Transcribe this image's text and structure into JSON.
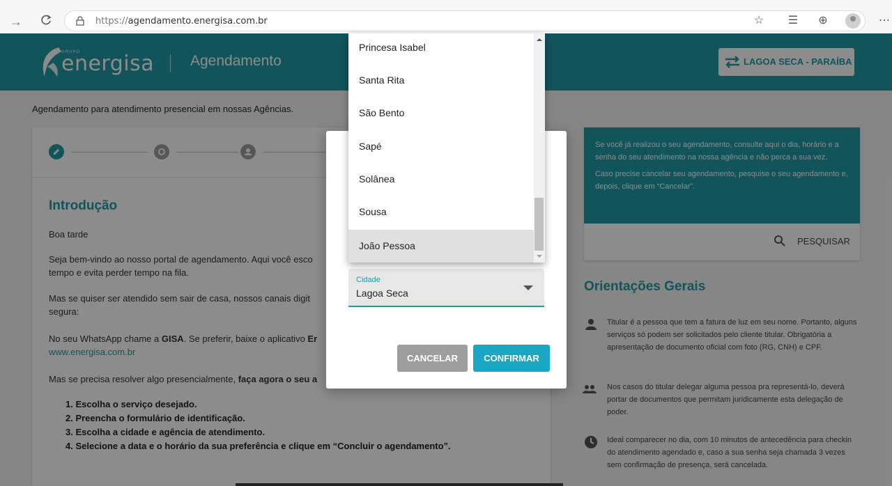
{
  "browser": {
    "url_scheme": "https://",
    "url_host": "agendamento.energisa.com.br"
  },
  "header": {
    "logo_group": "GRUPO",
    "logo_name": "energisa",
    "title": "Agendamento",
    "location_button": "LAGOA SECA - PARAÍBA"
  },
  "intro_line": "Agendamento para atendimento presencial em nossas Agências.",
  "main": {
    "section_title": "Introdução",
    "greeting": "Boa tarde",
    "p1_line1": "Seja bem-vindo ao nosso portal de agendamento. Aqui você esco",
    "p1_line2": "tempo e evita perder tempo na fila.",
    "p2_line1": "Mas se quiser ser atendido sem sair de casa, nossos canais digit",
    "p2_line2": "segura:",
    "p3_prefix": "No seu WhatsApp chame a ",
    "p3_gisa": "GISA",
    "p3_mid": ". Se preferir, baixe o aplicativo ",
    "p3_bold": "Er",
    "p3_link": "www.energisa.com.br",
    "p4_prefix": "Mas se precisa resolver algo presencialmente, ",
    "p4_bold": "faça agora o seu a",
    "steps": [
      "1. Escolha o serviço desejado.",
      "2. Preencha o formulário de identificação.",
      "3. Escolha a cidade e agência de atendimento.",
      "4. Selecione a data e o horário da sua preferência e clique em “Concluir o agendamento”."
    ]
  },
  "info_card": {
    "text1": "Se você já realizou o seu agendamento, consulte aqui o dia, horário e a senha do seu atendimento na nossa agência e não perca a sua vez.",
    "text2": "Caso precise cancelar seu agendamento, pesquise o seu agendamento e, depois, clique em “Cancelar”.",
    "search_label": "PESQUISAR"
  },
  "orientations": {
    "title": "Orientações Gerais",
    "items": [
      "Titular é a pessoa que tem a fatura de luz em seu nome. Portanto, alguns serviços só podem ser solicitados pelo cliente titular. Obrigatória a apresentação de documento oficial com foto (RG, CNH) e CPF.",
      "Nos casos do titular delegar alguma pessoa pra representá-lo, deverá portar de documentos que permitam juridicamente esta delegação de poder.",
      "Ideal comparecer no dia, com 10 minutos de antecedência para checkin do atendimento agendado e, caso a sua senha seja chamada 3 vezes sem confirmação de presença, será cancelada."
    ]
  },
  "modal": {
    "city_label": "Cidade",
    "city_value": "Lagoa Seca",
    "cancel_label": "CANCELAR",
    "confirm_label": "CONFIRMAR"
  },
  "dropdown": {
    "options": [
      "Princesa Isabel",
      "Santa Rita",
      "São Bento",
      "Sapé",
      "Solânea",
      "Sousa",
      "João Pessoa"
    ],
    "highlighted": "João Pessoa"
  },
  "colors": {
    "brand": "#1f9aa5",
    "confirm": "#1ba6c4",
    "cancel": "#9e9e9e"
  }
}
